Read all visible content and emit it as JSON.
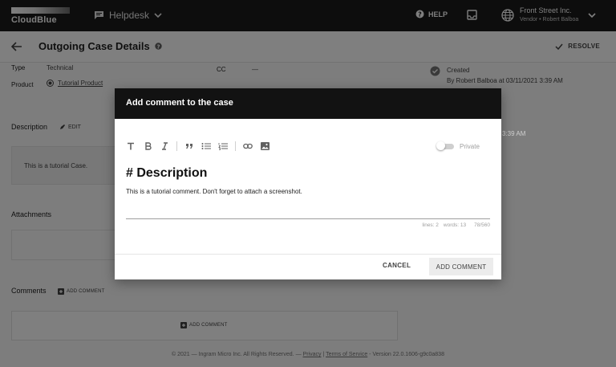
{
  "navbar": {
    "logo": "CloudBlue",
    "module": "Helpdesk",
    "help": "HELP",
    "account": {
      "name": "Front Street Inc.",
      "role": "Vendor • Robert Balboa"
    }
  },
  "subheader": {
    "title": "Outgoing Case Details",
    "resolve": "RESOLVE"
  },
  "details": {
    "type_label": "Type",
    "type_value": "Technical",
    "product_label": "Product",
    "product_value": "Tutorial Product",
    "cc_label": "CC",
    "cc_value": "—"
  },
  "activity": {
    "created_label": "Created",
    "created_by": "By Robert Balboa at 03/11/2021 3:39 AM",
    "partial_time": "3:39 AM"
  },
  "description": {
    "label": "Description",
    "edit": "EDIT",
    "text": "This is a tutorial Case."
  },
  "attachments": {
    "label": "Attachments"
  },
  "comments": {
    "label": "Comments",
    "add": "ADD COMMENT",
    "add_box": "ADD COMMENT"
  },
  "footer": {
    "copyright": "© 2021 — Ingram Micro Inc. All Rights Reserved. —",
    "privacy": "Privacy",
    "sep": "|",
    "terms": "Terms of Service",
    "version": "- Version 22.0.1606-g9c0a838"
  },
  "modal": {
    "title": "Add comment to the case",
    "private_label": "Private",
    "heading": "# Description",
    "body": "This is a tutorial comment. Don't forget to attach a screenshot.",
    "stats": {
      "lines": "lines: 2",
      "words": "words: 13",
      "chars": "78/560"
    },
    "cancel": "CANCEL",
    "submit": "ADD COMMENT"
  },
  "icons": {
    "helpdesk": "chat-icon",
    "help": "help-circle-icon",
    "inbox": "inbox-icon",
    "account": "globe-icon",
    "back": "arrow-left-icon",
    "info": "info-icon",
    "resolve": "check-icon",
    "created": "check-circle-icon"
  }
}
